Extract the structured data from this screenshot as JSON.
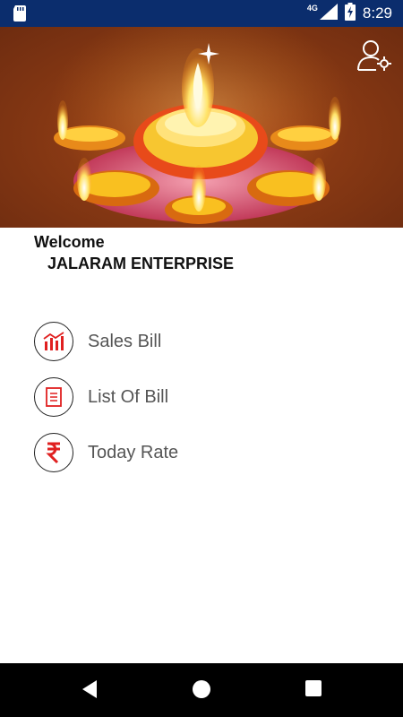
{
  "status_bar": {
    "network": "4G",
    "time": "8:29"
  },
  "banner": {
    "image": "diwali-diya-lamps",
    "profile_icon": "user-settings-icon"
  },
  "greeting": {
    "welcome": "Welcome",
    "company": "JALARAM ENTERPRISE"
  },
  "menu": {
    "items": [
      {
        "label": "Sales Bill",
        "icon": "bar-chart-icon"
      },
      {
        "label": "List Of Bill",
        "icon": "document-list-icon"
      },
      {
        "label": "Today Rate",
        "icon": "rupee-icon"
      }
    ]
  },
  "colors": {
    "status_bar": "#0b2d6d",
    "icon_accent": "#e02020",
    "label_text": "#555555",
    "nav_bar": "#000000"
  }
}
